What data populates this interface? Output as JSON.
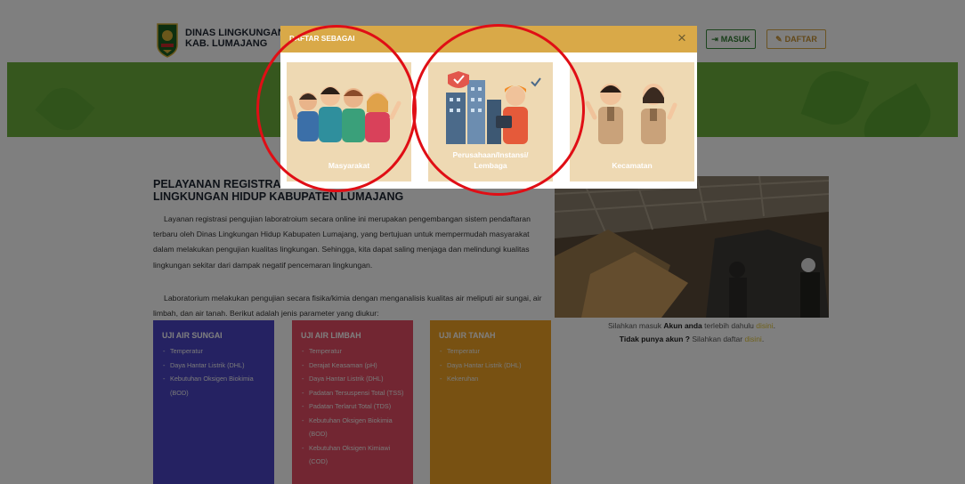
{
  "header": {
    "brand_line1": "DINAS LINGKUNGAN H",
    "brand_line2": "KAB. LUMAJANG",
    "login_label": "MASUK",
    "register_label": "DAFTAR",
    "login_icon": "sign-in-icon",
    "register_icon": "edit-icon"
  },
  "main": {
    "title_line1": "PELAYANAN REGISTRASI U",
    "title_line2": "LINGKUNGAN HIDUP KABUPATEN LUMAJANG",
    "paragraph1": "Layanan registrasi pengujian laboratroium secara online ini merupakan pengembangan sistem pendaftaran terbaru oleh Dinas Lingkungan Hidup Kabupaten Lumajang, yang bertujuan untuk mempermudah masyarakat dalam melakukan pengujian kualitas lingkungan. Sehingga, kita dapat saling menjaga dan melindungi kualitas lingkungan sekitar dari dampak negatif pencemaran lingkungan.",
    "paragraph2": "Laboratorium melakukan pengujian secara fisika/kimia dengan menganalisis kualitas air meliputi air sungai, air limbah, dan air tanah. Berikut adalah jenis parameter yang diukur:",
    "cards": [
      {
        "title": "UJI AIR SUNGAI",
        "items": [
          "Temperatur",
          "Daya Hantar Listrik (DHL)",
          "Kebutuhan Oksigen Biokimia (BOD)"
        ]
      },
      {
        "title": "UJI AIR LIMBAH",
        "items": [
          "Temperatur",
          "Derajat Keasaman (pH)",
          "Daya Hantar Listrik (DHL)",
          "Padatan Tersuspensi Total (TSS)",
          "Padatan Terlarut Total (TDS)",
          "Kebutuhan Oksigen Biokimia (BOD)",
          "Kebutuhan Oksigen Kimiawi (COD)"
        ]
      },
      {
        "title": "UJI AIR TANAH",
        "items": [
          "Temperatur",
          "Daya Hantar Listrik (DHL)",
          "Kekeruhan"
        ]
      }
    ],
    "login_prompt": {
      "pre": "Silahkan masuk ",
      "bold": "Akun anda",
      "mid": " terlebih dahulu ",
      "link": "disini",
      "end": "."
    },
    "register_prompt": {
      "bold": "Tidak punya akun ?",
      "mid": " Silahkan daftar ",
      "link": "disini",
      "end": "."
    }
  },
  "modal": {
    "title": "DAFTAR SEBAGAI",
    "close": "×",
    "options": [
      {
        "label": "Masyarakat"
      },
      {
        "label_line1": "Perusahaan/Instansi/",
        "label_line2": "Lembaga"
      },
      {
        "label": "Kecamatan"
      }
    ]
  },
  "colors": {
    "accent_gold": "#d9a948",
    "green": "#6cae3d",
    "card_blue": "#4b44c4",
    "card_red": "#e44d64",
    "card_orange": "#f1a324",
    "annotation_red": "#e00e15"
  }
}
